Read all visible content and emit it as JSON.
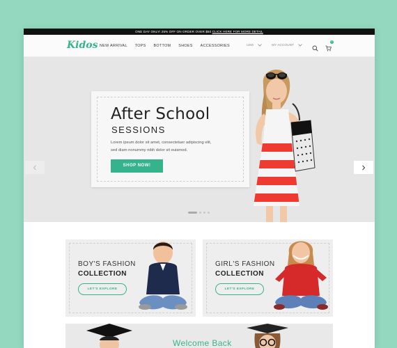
{
  "topbar": {
    "promo": "ONE DAY ONLY! 25% OFF ON ORDER OVER $50",
    "link": "CLICK HERE FOR MORE DETAIL"
  },
  "header": {
    "logo": "Kidos",
    "nav": [
      "NEW ARRIVAL",
      "TOPS",
      "BOTTOM",
      "SHOES",
      "ACCESSORIES"
    ],
    "currency": "USD",
    "account": "MY ACCOUNT",
    "cart_count": "0"
  },
  "hero": {
    "title": "After School",
    "subtitle": "SESSIONS",
    "text_line1": "Lorem ipsum dolor sit amet, consectetuer adipiscing elit,",
    "text_line2": "sed diam nonummy nibh dolor sit euismod.",
    "button": "SHOP NOW!",
    "slide_count": 4,
    "active_slide": 1
  },
  "collections": [
    {
      "line1": "BOY'S FASHION",
      "line2": "COLLECTION",
      "button": "LET'S EXPLORE"
    },
    {
      "line1": "GIRL'S FASHION",
      "line2": "COLLECTION",
      "button": "LET'S EXPLORE"
    }
  ],
  "welcome": {
    "title": "Welcome Back"
  },
  "colors": {
    "accent": "#35b48c",
    "background": "#93d8bf",
    "topbar": "#111111"
  }
}
